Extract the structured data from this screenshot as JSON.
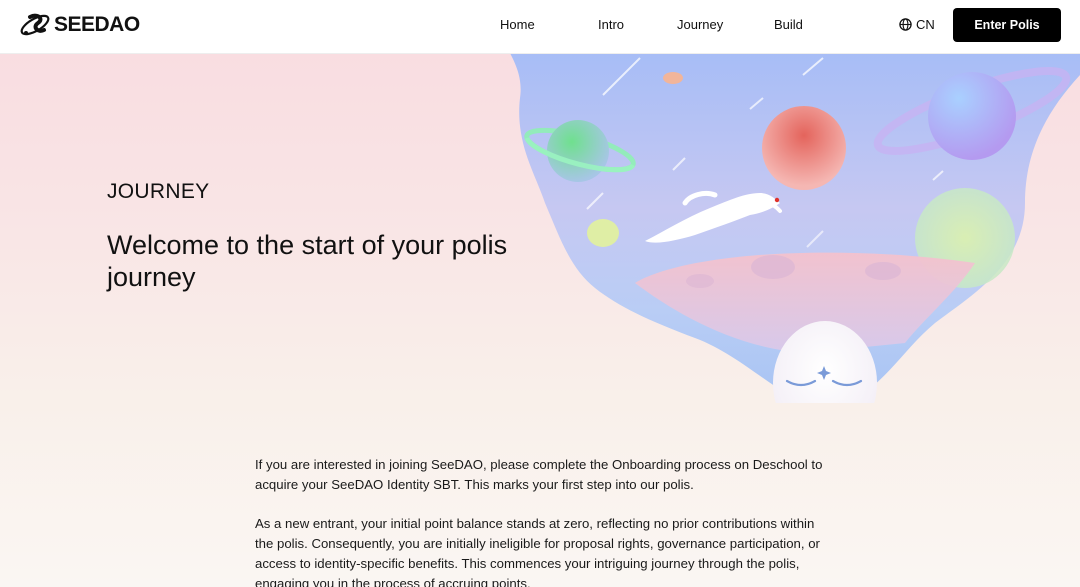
{
  "header": {
    "logo_text": "SEEDAO",
    "nav": [
      "Home",
      "Intro",
      "Journey",
      "Build"
    ],
    "lang": "CN",
    "cta": "Enter Polis"
  },
  "hero": {
    "label": "JOURNEY",
    "title": "Welcome to the start of your polis journey"
  },
  "content": {
    "paragraphs": [
      "If you are interested in joining SeeDAO, please complete the Onboarding process on Deschool to acquire your SeeDAO Identity SBT. This marks your first step into our polis.",
      "As a new entrant, your initial point balance stands at zero, reflecting no prior contributions within the polis. Consequently, you are initially ineligible for proposal rights, governance participation, or access to identity-specific benefits. This commences your intriguing journey through the polis, engaging you in the process of accruing points."
    ]
  },
  "colors": {
    "cta_bg": "#000000",
    "hero_pink": "#f9dde1",
    "sky_blue": "#a9bff5"
  }
}
